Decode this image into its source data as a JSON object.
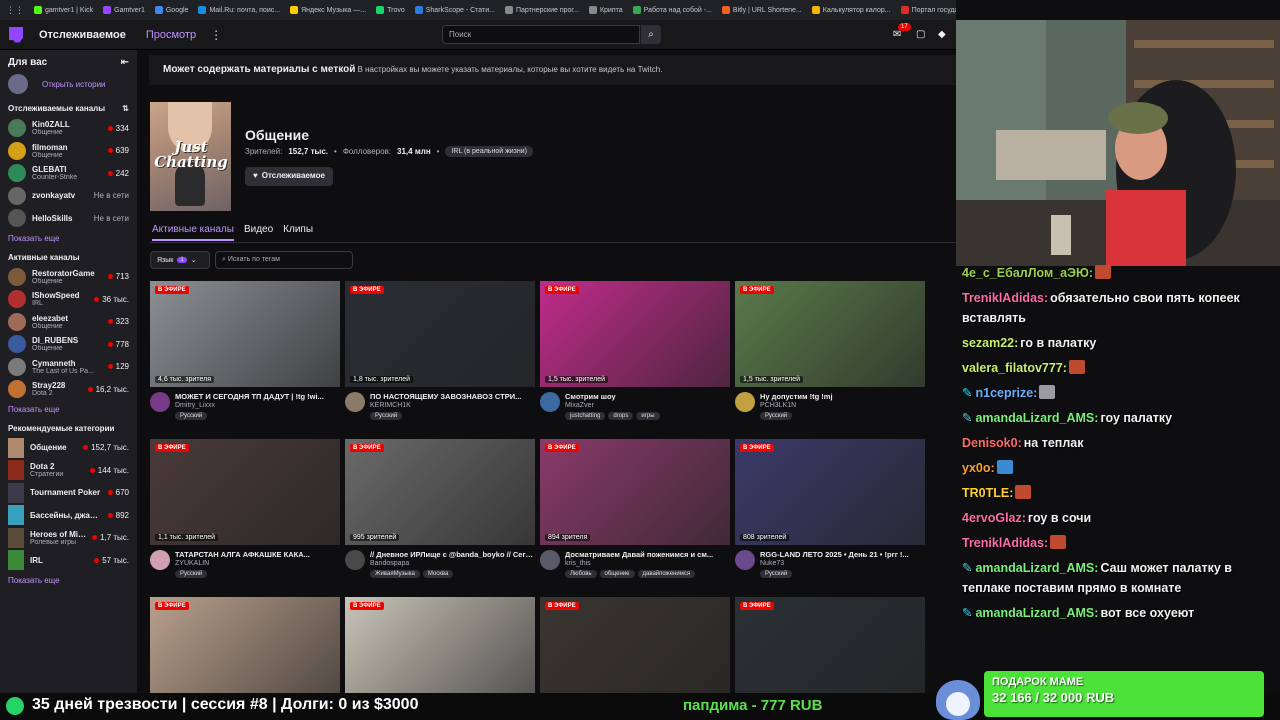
{
  "browser": {
    "bookmarks": [
      {
        "label": "gamtver1 | Kick",
        "color": "#53fc18"
      },
      {
        "label": "Gamtver1",
        "color": "#9147ff"
      },
      {
        "label": "Google",
        "color": "#4285f4"
      },
      {
        "label": "Mail.Ru: почта, поис...",
        "color": "#168de2"
      },
      {
        "label": "Яндекс Музыка —...",
        "color": "#ffcc00"
      },
      {
        "label": "Trovo",
        "color": "#19d66b"
      },
      {
        "label": "SharkScope - Стати...",
        "color": "#2c7be5"
      },
      {
        "label": "Партнерские прог...",
        "color": "#8a8a8a"
      },
      {
        "label": "Крипта",
        "color": "#8a8a8a"
      },
      {
        "label": "Работа над собой -...",
        "color": "#34a853"
      },
      {
        "label": "Bitly | URL Shortene...",
        "color": "#ee6123"
      },
      {
        "label": "Калькулятор калор...",
        "color": "#f4b400"
      },
      {
        "label": "Портал государств...",
        "color": "#d93025"
      }
    ]
  },
  "topnav": {
    "following": "Отслеживаемое",
    "browse": "Просмотр",
    "search_placeholder": "Поиск",
    "notifications": "17"
  },
  "sidebar": {
    "for_you": "Для вас",
    "open_stories": "Открыть истории",
    "followed_header": "Отслеживаемые каналы",
    "followed": [
      {
        "name": "Kin0ZALL",
        "sub": "Общение",
        "viewers": "334",
        "color": "#4a7a5a"
      },
      {
        "name": "filmoman",
        "sub": "Общение",
        "viewers": "639",
        "color": "#d4a017"
      },
      {
        "name": "GLEBATI",
        "sub": "Counter-Strike",
        "viewers": "242",
        "color": "#2e8b57"
      },
      {
        "name": "zvonkayatv",
        "sub": "",
        "offline": "Не в сети",
        "color": "#666"
      },
      {
        "name": "HelloSkills",
        "sub": "",
        "offline": "Не в сети",
        "color": "#555"
      }
    ],
    "show_more": "Показать еще",
    "active_header": "Активные каналы",
    "active": [
      {
        "name": "RestoratorGame",
        "sub": "Общение",
        "viewers": "713",
        "color": "#7a5a3a"
      },
      {
        "name": "IShowSpeed",
        "sub": "IRL",
        "viewers": "36 тыс.",
        "color": "#b03030"
      },
      {
        "name": "eleezabet",
        "sub": "Общение",
        "viewers": "323",
        "color": "#a06a5a"
      },
      {
        "name": "DI_RUBENS",
        "sub": "Общение",
        "viewers": "778",
        "color": "#3a5aa0"
      },
      {
        "name": "Cymanneth",
        "sub": "The Last of Us Pa...",
        "viewers": "129",
        "color": "#7a7a7a"
      },
      {
        "name": "Stray228",
        "sub": "Dota 2",
        "viewers": "16,2 тыс.",
        "color": "#c07030"
      }
    ],
    "show_more_2": "Показать еще",
    "rec_header": "Рекомендуемые категории",
    "categories": [
      {
        "name": "Общение",
        "sub": "",
        "viewers": "152,7 тыс.",
        "color": "#b08a70"
      },
      {
        "name": "Dota 2",
        "sub": "Стратегии",
        "viewers": "144 тыс.",
        "color": "#8a2a1a"
      },
      {
        "name": "Tournament Poker",
        "sub": "",
        "viewers": "670",
        "color": "#3a3a4a"
      },
      {
        "name": "Бассейны, джакуз...",
        "sub": "",
        "viewers": "892",
        "color": "#3aa0c0"
      },
      {
        "name": "Heroes of Mig...",
        "sub": "Ролевые игры",
        "viewers": "1,7 тыс.",
        "color": "#5a4a3a"
      },
      {
        "name": "IRL",
        "sub": "",
        "viewers": "57 тыс.",
        "color": "#3a8a3a"
      }
    ],
    "show_more_3": "Показать еще"
  },
  "main": {
    "banner_bold": "Может содержать материалы с меткой",
    "banner_rest": " В настройках вы можете указать материалы, которые вы хотите видеть на Twitch.",
    "boxart_text": "Just Chatting",
    "title": "Общение",
    "viewers_label": "Зрителей:",
    "viewers_value": "152,7 тыс.",
    "followers_label": "Фолловеров:",
    "followers_value": "31,4 млн",
    "tag": "IRL (в реальной жизни)",
    "follow_button": "Отслеживаемое",
    "tabs": [
      "Активные каналы",
      "Видео",
      "Клипы"
    ],
    "lang_label": "Язык",
    "lang_count": "1",
    "tag_search_placeholder": "Искать по тегам",
    "live_label": "В ЭФИРЕ",
    "cards": [
      {
        "viewers": "4,6 тыс. зрителя",
        "title": "МОЖЕТ И СЕГОДНЯ ТП ДАДУТ | !tg !wi...",
        "name": "Dmitry_Lixxx",
        "tags": [
          "Русский"
        ],
        "bg": "#8c8f95",
        "av": "#7a3a8a"
      },
      {
        "viewers": "1,8 тыс. зрителей",
        "title": "ПО НАСТОЯЩЕМУ ЗАВОЗНАВОЗ СТРИ...",
        "name": "KERIMCH1K",
        "tags": [
          "Русский"
        ],
        "bg": "#2a2d34",
        "av": "#8a7a6a"
      },
      {
        "viewers": "1,5 тыс. зрителей",
        "title": "Смотрим шоу",
        "name": "MixaZver",
        "tags": [
          "justchatting",
          "drops",
          "игры"
        ],
        "bg": "#c02c8a",
        "av": "#3a6aa0"
      },
      {
        "viewers": "1,5 тыс. зрителей",
        "title": "Ну допустим !tg !mj",
        "name": "PCH3LK1N",
        "tags": [
          "Русский"
        ],
        "bg": "#5a7a4a",
        "av": "#c0a040"
      },
      {
        "viewers": "1,1 тыс. зрителей",
        "title": "ТАТАРСТАН АЛГА АФКАШКЕ КАКА...",
        "name": "ZYUKALIN",
        "tags": [
          "Русский"
        ],
        "bg": "#4a3a3a",
        "av": "#d0a0b0"
      },
      {
        "viewers": "995 зрителей",
        "title": "// Дневное ИРЛище с @banda_boyko // Сегодня...",
        "name": "Bandospapa",
        "tags": [
          "ЖиваяМузыка",
          "Москва"
        ],
        "bg": "#6a6a6a",
        "av": "#4a4a4a"
      },
      {
        "viewers": "894 зрителя",
        "title": "Досматриваем Давай поженимся и см...",
        "name": "kris_this",
        "tags": [
          "Любовь",
          "общение",
          "давайпоженимся"
        ],
        "bg": "#8a3a6a",
        "av": "#5a5a6a"
      },
      {
        "viewers": "808 зрителей",
        "title": "RGG-LAND ЛЕТО 2025 • День 21 • !ргг !...",
        "name": "Nuke73",
        "tags": [
          "Русский"
        ],
        "bg": "#3a3a6a",
        "av": "#6a4a8a"
      },
      {
        "viewers": "",
        "title": "",
        "name": "",
        "tags": [],
        "bg": "#b9a08c",
        "av": "#555"
      },
      {
        "viewers": "",
        "title": "",
        "name": "",
        "tags": [],
        "bg": "#c8c4b8",
        "av": "#555"
      },
      {
        "viewers": "",
        "title": "",
        "name": "",
        "tags": [],
        "bg": "#3a3530",
        "av": "#555"
      },
      {
        "viewers": "",
        "title": "",
        "name": "",
        "tags": [],
        "bg": "#2a3035",
        "av": "#555"
      }
    ]
  },
  "chat": {
    "messages": [
      {
        "user": "4e_c_ЕбалЛом_аЭЮ:",
        "text": "",
        "ucolor": "#9ad04a",
        "emote": "#c04a30",
        "pin": false
      },
      {
        "user": "TreniklAdidas:",
        "text": "обязательно свои пять копеек вставлять",
        "ucolor": "#ff6aa8",
        "emote": "",
        "pin": false
      },
      {
        "user": "sezam22:",
        "text": "го в палатку",
        "ucolor": "#c6f06a",
        "emote": "",
        "pin": false
      },
      {
        "user": "valera_filatov777:",
        "text": "",
        "ucolor": "#c6f06a",
        "emote": "#c04a30",
        "pin": false
      },
      {
        "user": "n1ceprize:",
        "text": "",
        "ucolor": "#6ab0ff",
        "emote": "#9a9aa0",
        "pin": true
      },
      {
        "user": "amandaLizard_AMS:",
        "text": "гоу палатку",
        "ucolor": "#7af07a",
        "emote": "",
        "pin": true
      },
      {
        "user": "Denisok0:",
        "text": "на теплак",
        "ucolor": "#ff6a6a",
        "emote": "",
        "pin": false
      },
      {
        "user": "yx0o:",
        "text": "",
        "ucolor": "#ffa030",
        "emote": "#3a8ad0",
        "pin": false
      },
      {
        "user": "TR0TLE:",
        "text": "",
        "ucolor": "#ffd030",
        "emote": "#c04a30",
        "pin": false
      },
      {
        "user": "4ervoGlaz:",
        "text": "гоу в сочи",
        "ucolor": "#ff6aa8",
        "emote": "",
        "pin": false
      },
      {
        "user": "TreniklAdidas:",
        "text": "",
        "ucolor": "#ff6aa8",
        "emote": "#c04a30",
        "pin": false
      },
      {
        "user": "amandaLizard_AMS:",
        "text": "Саш может палатку в теплаке поставим прямо в комнате",
        "ucolor": "#7af07a",
        "emote": "",
        "pin": true
      },
      {
        "user": "amandaLizard_AMS:",
        "text": "вот все охуеют",
        "ucolor": "#7af07a",
        "emote": "",
        "pin": true
      }
    ]
  },
  "overlay": {
    "bottom_text": "35 дней  трезвости | сессия #8  | Долги: 0 из $3000",
    "donation": "папдима - 777 RUB",
    "goal_label": "ПОДАРОК МАМЕ",
    "goal_value": "32 166 / 32 000 RUB"
  }
}
